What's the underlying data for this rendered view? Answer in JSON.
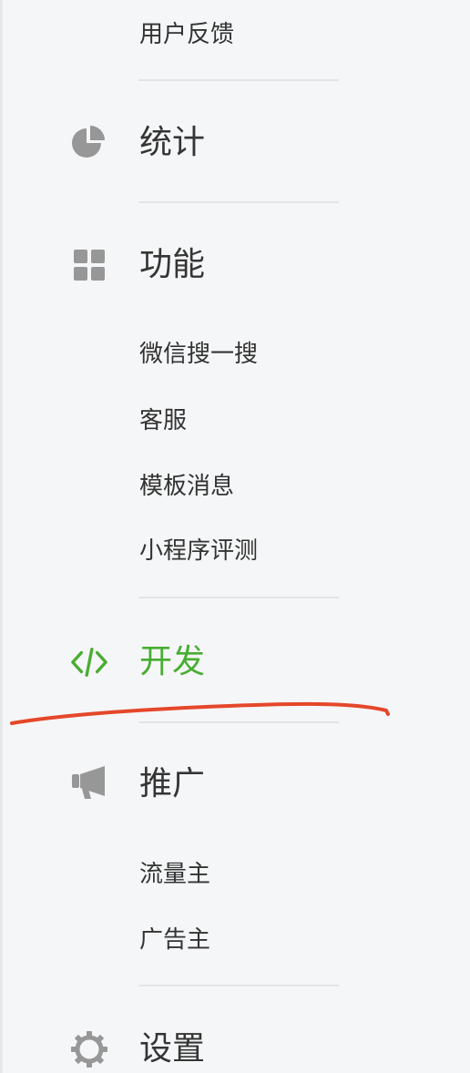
{
  "menu": {
    "feedback": "用户反馈",
    "stats": "统计",
    "features": "功能",
    "features_items": [
      "微信搜一搜",
      "客服",
      "模板消息",
      "小程序评测"
    ],
    "develop": "开发",
    "promotion": "推广",
    "promotion_items": [
      "流量主",
      "广告主"
    ],
    "settings": "设置"
  },
  "colors": {
    "active": "#48ad32",
    "text": "#353535",
    "icon": "#979797",
    "annotation": "#e5472a"
  },
  "icons": {
    "stats": "pie-chart-icon",
    "features": "grid-icon",
    "develop": "code-icon",
    "promotion": "megaphone-icon",
    "settings": "gear-icon"
  }
}
